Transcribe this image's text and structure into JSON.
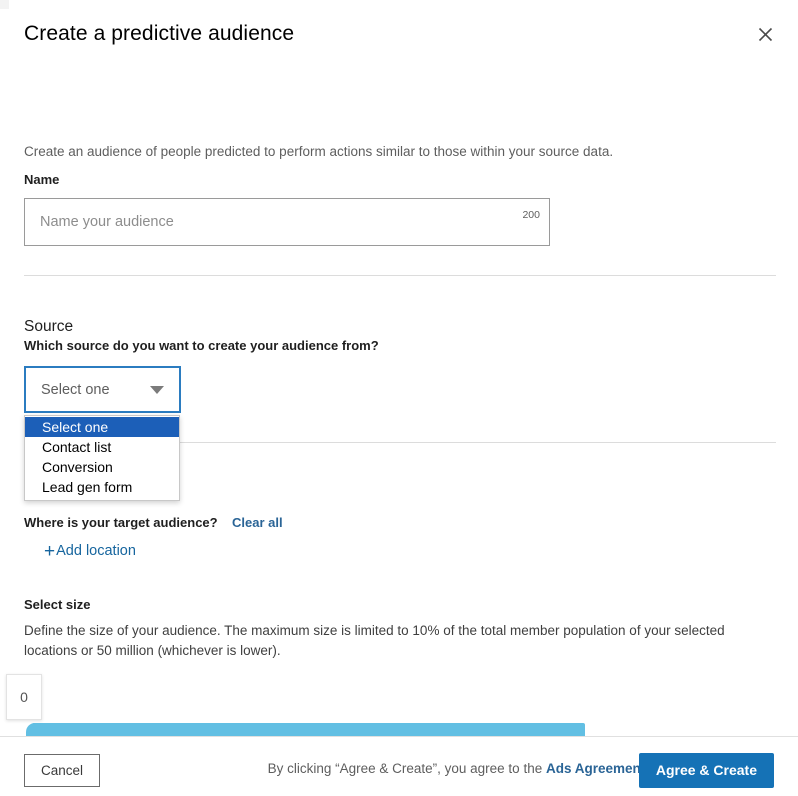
{
  "dialog": {
    "title": "Create a predictive audience",
    "close_icon": "close-icon",
    "intro": "Create an audience of people predicted to perform actions similar to those within your source data."
  },
  "name_section": {
    "label": "Name",
    "placeholder": "Name your audience",
    "value": "",
    "char_limit": "200"
  },
  "source_section": {
    "title": "Source",
    "question": "Which source do you want to create your audience from?",
    "selected": "Select one",
    "caret_icon": "chevron-down-icon",
    "options": [
      {
        "label": "Select one",
        "selected": true
      },
      {
        "label": "Contact list",
        "selected": false
      },
      {
        "label": "Conversion",
        "selected": false
      },
      {
        "label": "Lead gen form",
        "selected": false
      }
    ]
  },
  "location_section": {
    "question": "Where is your target audience?",
    "clear_all": "Clear all",
    "plus_icon": "+",
    "add_location": "Add location"
  },
  "size_section": {
    "title": "Select size",
    "description": "Define the size of your audience. The maximum size is limited to 10% of the total member population of your selected locations or 50 million (whichever is lower).",
    "slider_value": "0"
  },
  "footer": {
    "cancel": "Cancel",
    "agreement_prefix": "By clicking “Agree & Create”, you agree to the ",
    "agreement_link": "Ads Agreement.",
    "primary": "Agree & Create"
  },
  "colors": {
    "accent_blue": "#1572b6",
    "link_blue": "#2a6496",
    "focus_blue": "#2b7cc0",
    "option_highlight": "#1c5fb8",
    "slider_fill": "#62bfe3"
  }
}
